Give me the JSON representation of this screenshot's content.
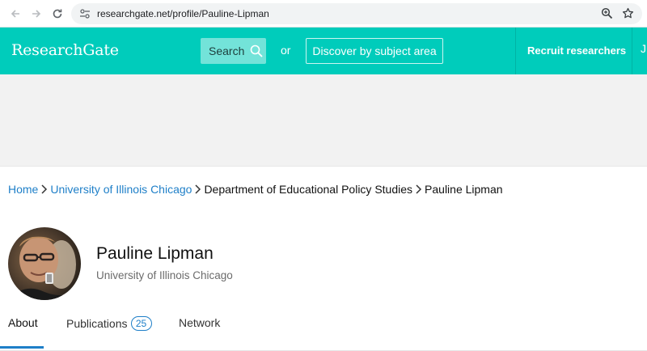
{
  "browser": {
    "url": "researchgate.net/profile/Pauline-Lipman"
  },
  "header": {
    "logo": "ResearchGate",
    "search_label": "Search",
    "or_label": "or",
    "discover_label": "Discover by subject area",
    "recruit_label": "Recruit researchers",
    "edge_fragment": "J"
  },
  "breadcrumb": {
    "items": [
      {
        "label": "Home"
      },
      {
        "label": "University of Illinois Chicago"
      },
      {
        "label": "Department of Educational Policy Studies"
      },
      {
        "label": "Pauline Lipman"
      }
    ]
  },
  "profile": {
    "name": "Pauline Lipman",
    "institution": "University of Illinois Chicago"
  },
  "tabs": [
    {
      "label": "About",
      "active": true
    },
    {
      "label": "Publications",
      "count": "25"
    },
    {
      "label": "Network"
    }
  ],
  "colors": {
    "brand": "#00ccbb",
    "link": "#1e7fc8"
  }
}
